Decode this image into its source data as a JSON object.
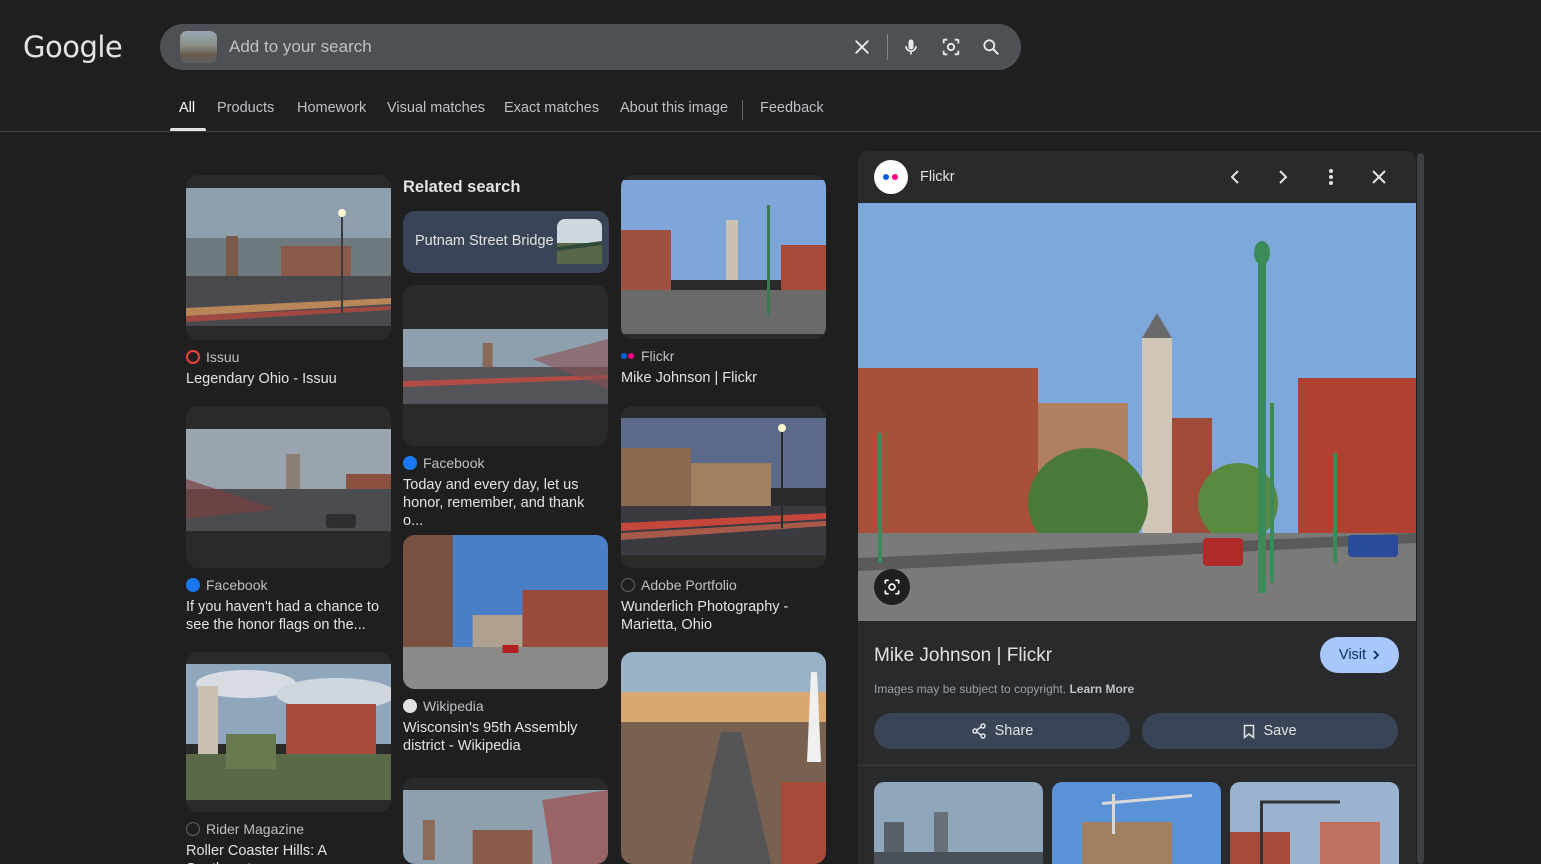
{
  "header": {
    "logo": "Google",
    "search_placeholder": "Add to your search"
  },
  "tabs": [
    {
      "label": "All",
      "active": true
    },
    {
      "label": "Products"
    },
    {
      "label": "Homework"
    },
    {
      "label": "Visual matches"
    },
    {
      "label": "Exact matches"
    },
    {
      "label": "About this image"
    },
    {
      "label": "Feedback"
    }
  ],
  "related": {
    "title": "Related search",
    "chip_label": "Putnam Street Bridge"
  },
  "results": [
    {
      "source": "Issuu",
      "title": "Legendary Ohio - Issuu",
      "fav_color": "#ea4335"
    },
    {
      "source": "Facebook",
      "title": "If you haven't had a chance to see the honor flags on the...",
      "fav_color": "#1877f2"
    },
    {
      "source": "Rider Magazine",
      "title": "Roller Coaster Hills: A Southeast",
      "fav_color": "#5f6368"
    },
    {
      "source": "Facebook",
      "title": "Today and every day, let us honor, remember, and thank o...",
      "fav_color": "#1877f2"
    },
    {
      "source": "Wikipedia",
      "title": "Wisconsin's 95th Assembly district - Wikipedia",
      "fav_color": "#e3e3e3"
    },
    {
      "source": "Flickr",
      "title": "Mike Johnson | Flickr",
      "fav_color": "#0063dc"
    },
    {
      "source": "Adobe Portfolio",
      "title": "Wunderlich Photography - Marietta, Ohio",
      "fav_color": "#5f6368"
    }
  ],
  "panel": {
    "source": "Flickr",
    "title": "Mike Johnson | Flickr",
    "visit_label": "Visit",
    "copyright": "Images may be subject to copyright.",
    "learn_more": "Learn More",
    "share_label": "Share",
    "save_label": "Save"
  },
  "colors": {
    "background": "#1f1f1f",
    "search_bg": "#4d5156",
    "accent": "#a8c7fa",
    "chip": "#394457"
  }
}
